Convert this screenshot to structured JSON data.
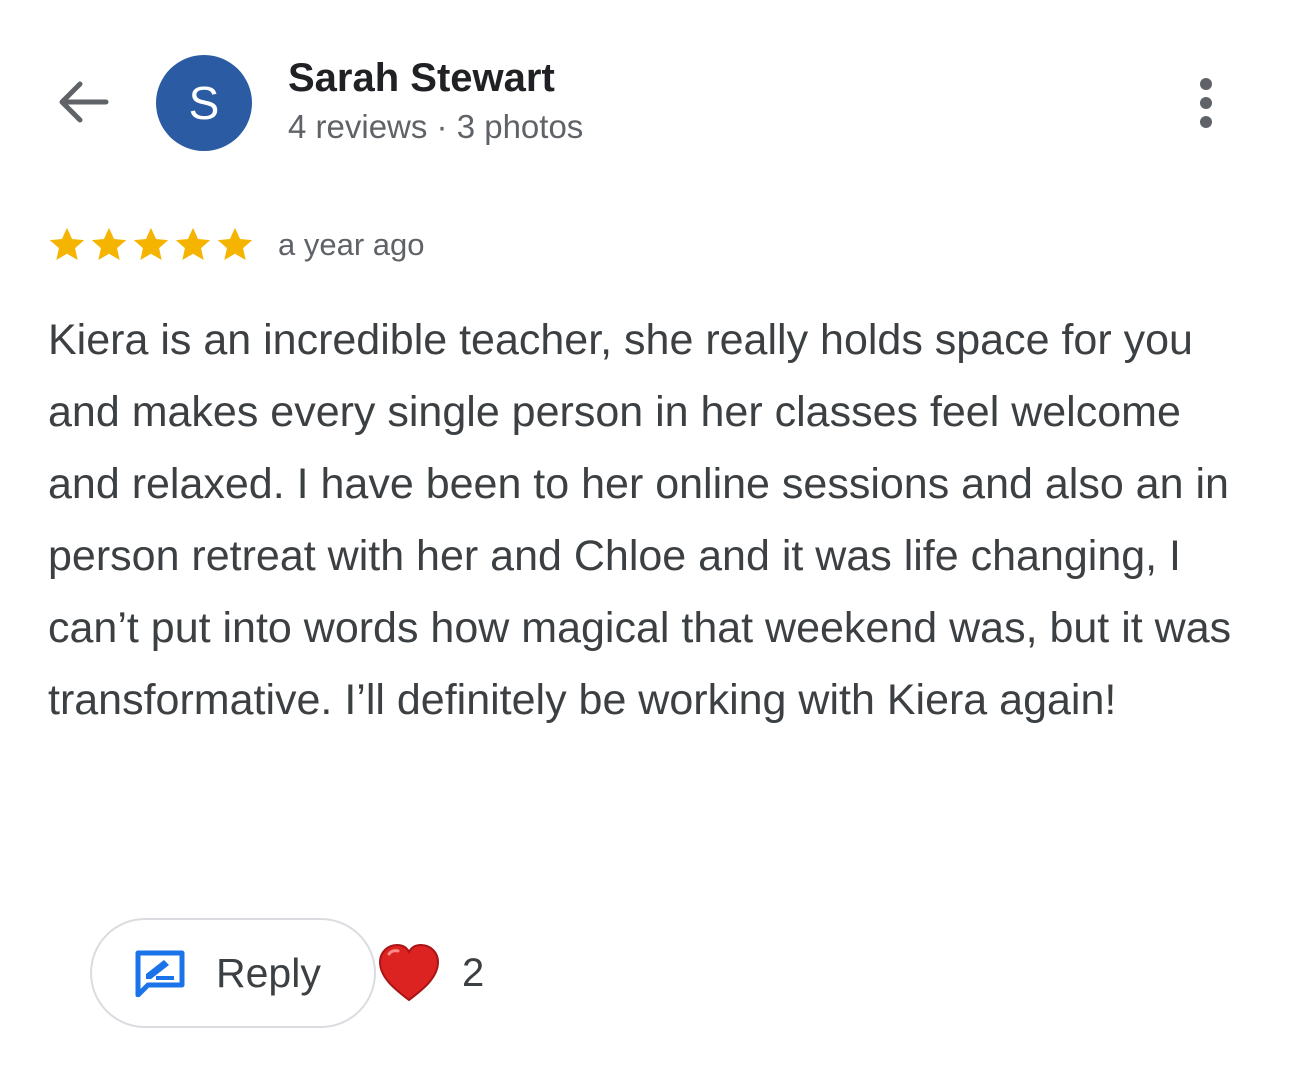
{
  "header": {
    "back_icon": "arrow-left-icon",
    "avatar_letter": "S",
    "avatar_color": "#2a5ba3",
    "name": "Sarah Stewart",
    "meta": "4 reviews · 3 photos",
    "more_icon": "more-vertical-icon"
  },
  "review": {
    "rating": 5,
    "rating_max": 5,
    "star_color": "#f4b400",
    "time": "a year ago",
    "text": "Kiera is an incredible teacher, she really holds space for you and makes every single person in her classes feel welcome and relaxed. I have been to her online sessions and also an in person retreat with her and Chloe and it was life changing, I can’t put into words how magical that weekend was, but it was transformative. I’ll definitely be working with Kiera again!"
  },
  "actions": {
    "reply_icon": "reply-edit-icon",
    "reply_label": "Reply",
    "reaction_icon": "red-heart-icon",
    "reaction_count": "2",
    "accent_color": "#1a73e8"
  }
}
